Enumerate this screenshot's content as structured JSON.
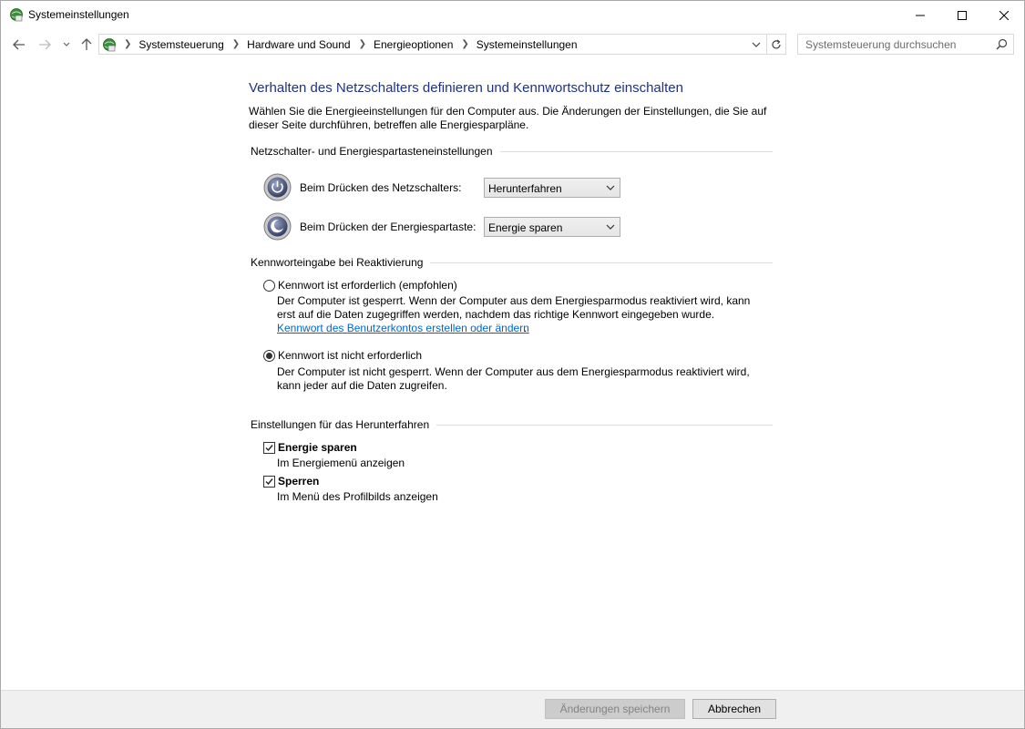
{
  "window": {
    "title": "Systemeinstellungen"
  },
  "address_bar": {
    "breadcrumbs": [
      "Systemsteuerung",
      "Hardware und Sound",
      "Energieoptionen",
      "Systemeinstellungen"
    ],
    "search_placeholder": "Systemsteuerung durchsuchen"
  },
  "main": {
    "title": "Verhalten des Netzschalters definieren und Kennwortschutz einschalten",
    "intro": "Wählen Sie die Energieeinstellungen für den Computer aus. Die Änderungen der Einstellungen, die Sie auf dieser Seite durchführen, betreffen alle Energiesparpläne.",
    "buttons_section": {
      "heading": "Netzschalter- und Energiespartasteneinstellungen",
      "power_button_label": "Beim Drücken des Netzschalters:",
      "power_button_value": "Herunterfahren",
      "sleep_button_label": "Beim Drücken der Energiespartaste:",
      "sleep_button_value": "Energie sparen"
    },
    "password_section": {
      "heading": "Kennworteingabe bei Reaktivierung",
      "option_required_label": "Kennwort ist erforderlich (empfohlen)",
      "option_required_desc": "Der Computer ist gesperrt. Wenn der Computer aus dem Energiesparmodus reaktiviert wird, kann erst auf die Daten zugegriffen werden, nachdem das richtige Kennwort eingegeben wurde.",
      "link": "Kennwort des Benutzerkontos erstellen oder ändern",
      "link_suffix": ".",
      "option_not_required_label": "Kennwort ist nicht erforderlich",
      "option_not_required_desc": "Der Computer ist nicht gesperrt. Wenn der Computer aus dem Energiesparmodus reaktiviert wird, kann jeder auf die Daten zugreifen.",
      "selected": "not_required"
    },
    "shutdown_section": {
      "heading": "Einstellungen für das Herunterfahren",
      "items": [
        {
          "label": "Energie sparen",
          "desc": "Im Energiemenü anzeigen",
          "checked": true
        },
        {
          "label": "Sperren",
          "desc": "Im Menü des Profilbilds anzeigen",
          "checked": true
        }
      ]
    }
  },
  "footer": {
    "save_label": "Änderungen speichern",
    "cancel_label": "Abbrechen"
  },
  "colors": {
    "title_blue": "#1e3287",
    "link_blue": "#0066cc"
  }
}
